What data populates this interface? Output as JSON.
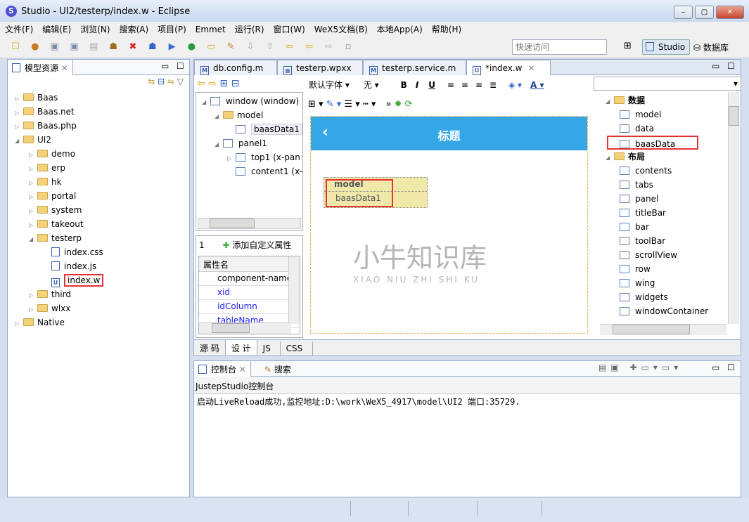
{
  "window": {
    "title": "Studio - UI2/testerp/index.w - Eclipse",
    "app_icon": "S"
  },
  "menu": [
    "文件(F)",
    "编辑(E)",
    "浏览(N)",
    "搜索(A)",
    "项目(P)",
    "Emmet",
    "运行(R)",
    "窗口(W)",
    "WeX5文档(B)",
    "本地App(A)",
    "帮助(H)"
  ],
  "toolbar": {
    "quick_access_placeholder": "快速访问",
    "perspective_studio": "Studio",
    "perspective_db": "数据库"
  },
  "left_panel": {
    "title": "模型资源",
    "tree": [
      {
        "label": "Baas",
        "level": 0,
        "expanded": false
      },
      {
        "label": "Baas.net",
        "level": 0,
        "expanded": false
      },
      {
        "label": "Baas.php",
        "level": 0,
        "expanded": false
      },
      {
        "label": "UI2",
        "level": 0,
        "expanded": true
      },
      {
        "label": "demo",
        "level": 1,
        "expanded": false
      },
      {
        "label": "erp",
        "level": 1,
        "expanded": false
      },
      {
        "label": "hk",
        "level": 1,
        "expanded": false
      },
      {
        "label": "portal",
        "level": 1,
        "expanded": false
      },
      {
        "label": "system",
        "level": 1,
        "expanded": false
      },
      {
        "label": "takeout",
        "level": 1,
        "expanded": false
      },
      {
        "label": "testerp",
        "level": 1,
        "expanded": true
      },
      {
        "label": "index.css",
        "level": 2,
        "file": true
      },
      {
        "label": "index.js",
        "level": 2,
        "file": true
      },
      {
        "label": "index.w",
        "level": 2,
        "file": true,
        "highlighted": true
      },
      {
        "label": "third",
        "level": 1,
        "expanded": false
      },
      {
        "label": "wlxx",
        "level": 1,
        "expanded": false
      },
      {
        "label": "Native",
        "level": 0,
        "expanded": false
      }
    ]
  },
  "editor": {
    "tabs": [
      {
        "label": "db.config.m"
      },
      {
        "label": "testerp.wpxx"
      },
      {
        "label": "testerp.service.m"
      },
      {
        "label": "*index.w",
        "active": true
      }
    ],
    "font_select": "默认字体",
    "size_select": "无",
    "outline": [
      {
        "label": "window (window)",
        "level": 0
      },
      {
        "label": "model",
        "level": 1
      },
      {
        "label": "baasData1",
        "level": 2,
        "selected": true
      },
      {
        "label": "panel1",
        "level": 1
      },
      {
        "label": "top1 (x-pan",
        "level": 2
      },
      {
        "label": "content1 (x-",
        "level": 2
      }
    ],
    "props": {
      "tab_num": "1",
      "add_custom": "添加自定义属性",
      "header": "属性名",
      "rows": [
        "component-name",
        "xid",
        "idColumn",
        "tableName"
      ]
    },
    "canvas": {
      "title": "标题",
      "back_icon": "chevron-left",
      "model_label": "model",
      "data_label": "baasData1",
      "accent": "#35a7e6"
    },
    "bottom_tabs": [
      "源 码",
      "设 计",
      "JS",
      "CSS"
    ]
  },
  "palette": {
    "groups": [
      {
        "label": "数据",
        "items": [
          "model",
          "data",
          "baasData"
        ]
      },
      {
        "label": "布局",
        "items": [
          "contents",
          "tabs",
          "panel",
          "titleBar",
          "bar",
          "toolBar",
          "scrollView",
          "row",
          "wing",
          "widgets",
          "windowContainer"
        ]
      }
    ],
    "highlighted": "baasData"
  },
  "console": {
    "tabs": [
      "控制台",
      "搜索"
    ],
    "title": "JustepStudio控制台",
    "output": "启动LiveReload成功,监控地址:D:\\work\\WeX5_4917\\model\\UI2 端口:35729."
  },
  "watermark": {
    "cn": "小牛知识库",
    "en": "XIAO NIU ZHI SHI KU"
  }
}
